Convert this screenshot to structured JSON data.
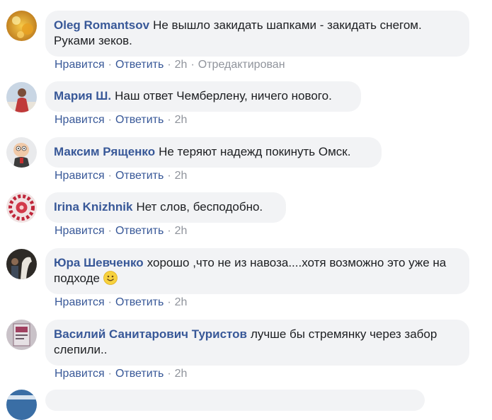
{
  "comments": [
    {
      "author": "Oleg Romantsov",
      "text": "Не вышло закидать шапками - закидать снегом. Руками зеков.",
      "like": "Нравится",
      "reply": "Ответить",
      "time": "2h",
      "edited": "Отредактирован",
      "avatar": "avatar-yellow-bokeh"
    },
    {
      "author": "Мария Ш.",
      "text": "Наш ответ Чемберлену, ничего нового.",
      "like": "Нравится",
      "reply": "Ответить",
      "time": "2h",
      "avatar": "avatar-person-outdoors"
    },
    {
      "author": "Максим Рященко",
      "text": "Не теряют надежд покинуть Омск.",
      "like": "Нравится",
      "reply": "Ответить",
      "time": "2h",
      "avatar": "avatar-cartoon-character"
    },
    {
      "author": "Irina Knizhnik",
      "text": "Нет слов, бесподобно.",
      "like": "Нравится",
      "reply": "Ответить",
      "time": "2h",
      "avatar": "avatar-red-pattern"
    },
    {
      "author": "Юра Шевченко",
      "text": "хорошо ,что не из навоза....хотя возможно это уже на подходе",
      "like": "Нравится",
      "reply": "Ответить",
      "time": "2h",
      "emoji": "smile-emoji-icon",
      "avatar": "avatar-person-with-horse"
    },
    {
      "author": "Василий Санитарович Туристов",
      "text": "лучше бы стремянку через забор слепили..",
      "like": "Нравится",
      "reply": "Ответить",
      "time": "2h",
      "avatar": "avatar-poster"
    }
  ],
  "colors": {
    "author": "#385898",
    "bubble": "#f2f3f5",
    "meta": "#90949c"
  }
}
